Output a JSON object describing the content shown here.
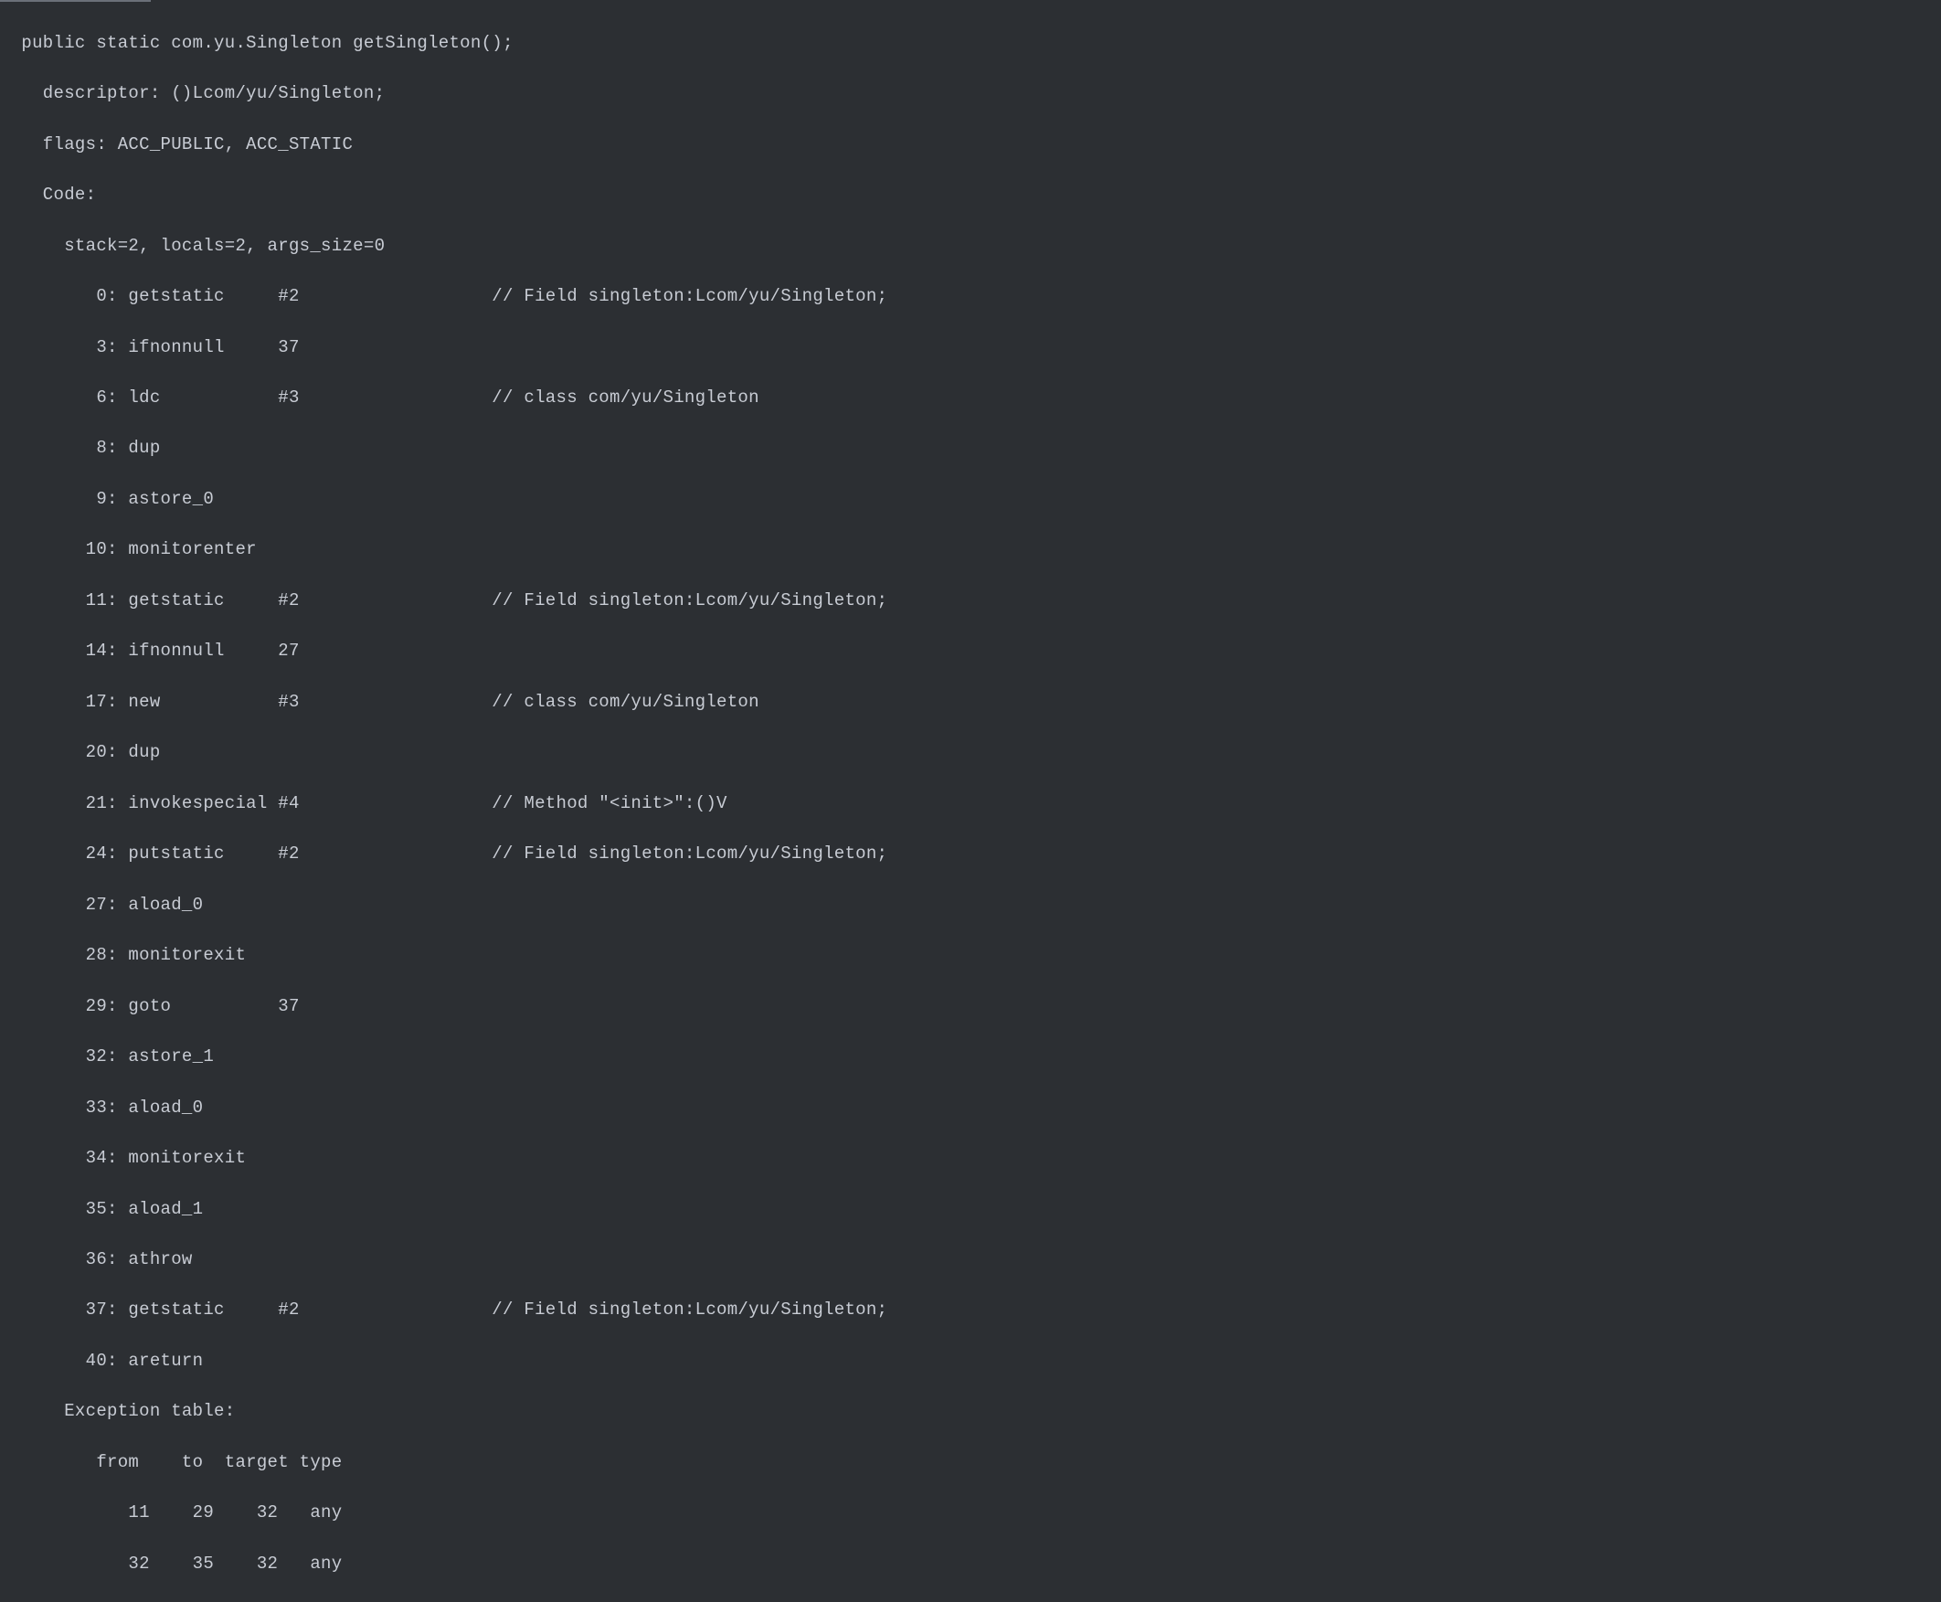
{
  "code": {
    "signature": "  public static com.yu.Singleton getSingleton();",
    "descriptor": "    descriptor: ()Lcom/yu/Singleton;",
    "flags": "    flags: ACC_PUBLIC, ACC_STATIC",
    "code_label": "    Code:",
    "stack": "      stack=2, locals=2, args_size=0",
    "instructions": [
      "         0: getstatic     #2                  // Field singleton:Lcom/yu/Singleton;",
      "         3: ifnonnull     37",
      "         6: ldc           #3                  // class com/yu/Singleton",
      "         8: dup",
      "         9: astore_0",
      "        10: monitorenter",
      "        11: getstatic     #2                  // Field singleton:Lcom/yu/Singleton;",
      "        14: ifnonnull     27",
      "        17: new           #3                  // class com/yu/Singleton",
      "        20: dup",
      "        21: invokespecial #4                  // Method \"<init>\":()V",
      "        24: putstatic     #2                  // Field singleton:Lcom/yu/Singleton;",
      "        27: aload_0",
      "        28: monitorexit",
      "        29: goto          37",
      "        32: astore_1",
      "        33: aload_0",
      "        34: monitorexit",
      "        35: aload_1",
      "        36: athrow",
      "        37: getstatic     #2                  // Field singleton:Lcom/yu/Singleton;",
      "        40: areturn"
    ],
    "exception_table_label": "      Exception table:",
    "exception_header": "         from    to  target type",
    "exception_rows": [
      "            11    29    32   any",
      "            32    35    32   any"
    ]
  }
}
